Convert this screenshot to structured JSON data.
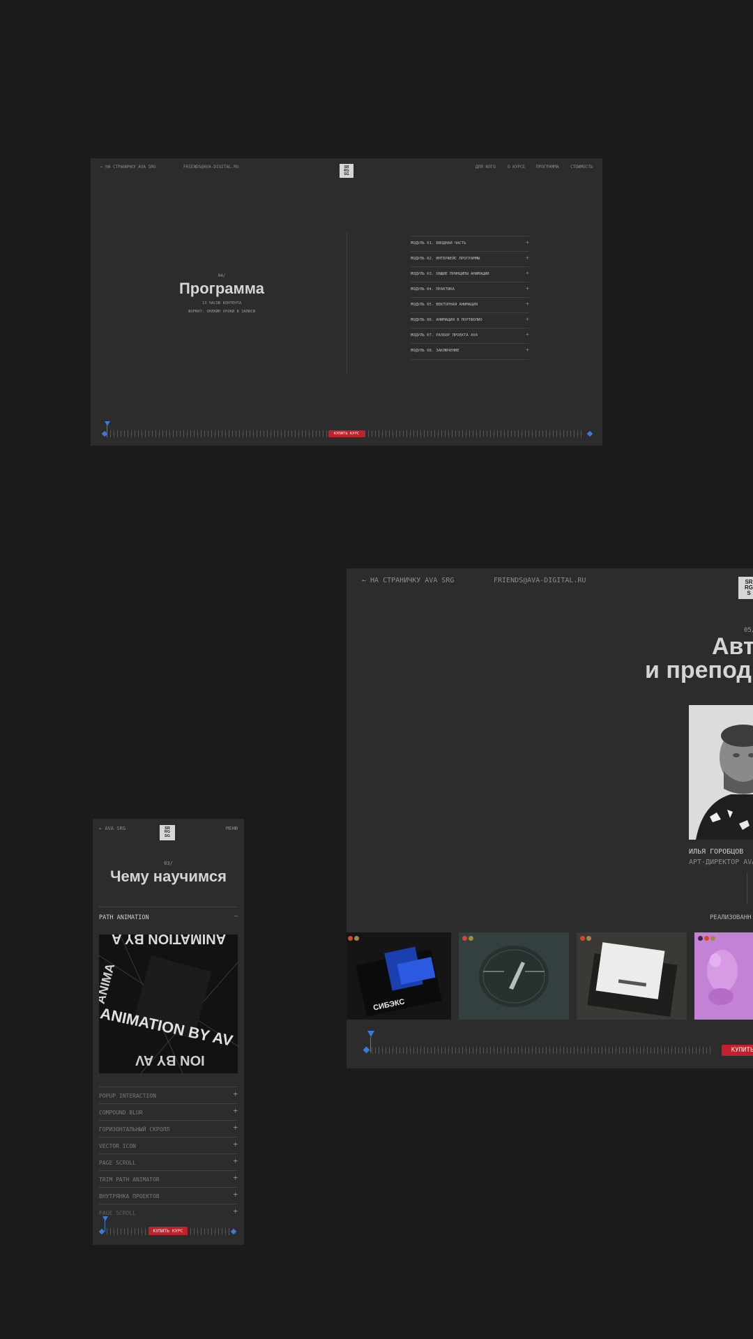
{
  "screen1": {
    "back_link": "← НА СТРАНИЧКУ AVA SRG",
    "email": "FRIENDS@AVA-DIGITAL.RU",
    "logo": [
      "SR",
      "RG",
      "SG"
    ],
    "nav": [
      "ДЛЯ КОГО",
      "О КУРСЕ",
      "ПРОГРАММА",
      "СТОИМОСТЬ"
    ],
    "section_number": "04/",
    "title": "Программа",
    "subtitle_1": "13 ЧАСОВ КОНТЕНТА",
    "subtitle_2": "ФОРМАТ: ОНЛАЙН УРОКИ В ЗАПИСИ",
    "modules": [
      "МОДУЛЬ 01. ВВОДНАЯ ЧАСТЬ",
      "МОДУЛЬ 02. ИНТЕРФЕЙС ПРОГРАММЫ",
      "МОДУЛЬ 03. ОБЩИЕ ПРИНЦИПЫ АНИМАЦИИ",
      "МОДУЛЬ 04. ПРАКТИКА",
      "МОДУЛЬ 05. ВЕКТОРНАЯ АНИМАЦИЯ",
      "МОДУЛЬ 06. АНИМАЦИЯ В ПОРТФОЛИО",
      "МОДУЛЬ 07. РАЗБОР ПРОЕКТА AVA",
      "МОДУЛЬ 08. ЗАКЛЮЧЕНИЕ"
    ],
    "plus": "+",
    "buy_label": "КУПИТЬ КУРС"
  },
  "screen2": {
    "back_link": "← НА СТРАНИЧКУ AVA SRG",
    "email": "FRIENDS@AVA-DIGITAL.RU",
    "logo": [
      "SR",
      "RG",
      "S"
    ],
    "section_number": "05/",
    "title_line1": "Авт",
    "title_line2": "и препод",
    "author_name": "ИЛЬЯ ГОРОБЦОВ",
    "author_role": "АРТ-ДИРЕКТОР AVA",
    "projects_label": "РЕАЛИЗОВАНН",
    "card1_text": "СИБЭКС",
    "buy_label": "КУПИТЬ",
    "colors": {
      "red_dot": "#d9452b",
      "yellow_dot": "#a08a3c",
      "card4_bg": "#c482d6"
    }
  },
  "screen3": {
    "back_link": "← AVA SRG",
    "logo": [
      "SR",
      "RG",
      "SG"
    ],
    "menu": "МЕНЮ",
    "section_number": "03/",
    "title": "Чему научимся",
    "open_item": "PATH ANIMATION",
    "open_item_icon": "—",
    "poster_text_top": "ANIMATION BY A",
    "poster_text_mid": "ANIMATION BY AV",
    "poster_text_bot": "ION BY AV",
    "poster_text_side": "ANIMA",
    "items": [
      "POPUP INTERACTION",
      "COMPOUND BLUR",
      "ГОРИЗОНТАЛЬНЫЙ СКРОЛЛ",
      "VECTOR ICON",
      "PAGE SCROLL",
      "TRIM PATH ANIMATOR",
      "ВНУТРЯНКА ПРОЕКТОВ",
      "PAGE SCROLL"
    ],
    "plus": "+",
    "buy_label": "КУПИТЬ КУРС"
  },
  "colors": {
    "accent_blue": "#3c7ad8",
    "buy_red": "#c0212c",
    "background": "#1b1b1b",
    "panel": "#2c2c2c"
  }
}
